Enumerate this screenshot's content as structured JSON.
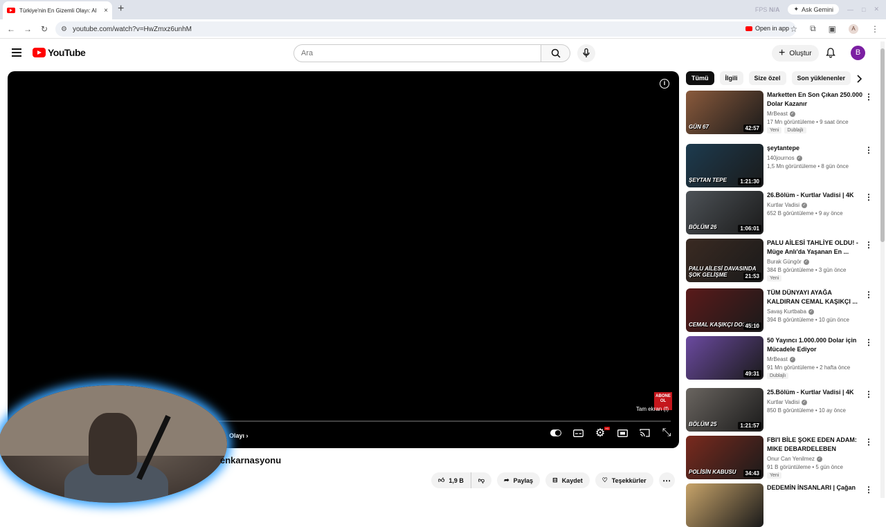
{
  "browser": {
    "tab_title": "Türkiye'nin En Gizemli Olayı: Al",
    "tab_close": "×",
    "new_tab": "+",
    "gemini_label": "Ask Gemini",
    "url": "youtube.com/watch?v=HwZmxz6unhM",
    "open_in_app": "Open in app",
    "profile_initial": "A",
    "fps_label": "FPS",
    "fps_value": "N/A"
  },
  "masthead": {
    "logo_text": "YouTube",
    "search_placeholder": "Ara",
    "create_label": "Oluştur",
    "avatar_initial": "B"
  },
  "player": {
    "abone_text": "ABONE OL",
    "fullscreen_tooltip": "Tam ekran (f)",
    "chapter_label": "Olayı",
    "progress_fraction": 0.0
  },
  "video": {
    "title_fragment": "enkarnasyonu",
    "like_count": "1,9 B",
    "share_label": "Paylaş",
    "save_label": "Kaydet",
    "thanks_label": "Teşekkürler"
  },
  "chips": [
    "Tümü",
    "İlgili",
    "Size özel",
    "Son yüklenenler"
  ],
  "recommendations": [
    {
      "title": "Marketten En Son Çıkan 250.000 Dolar Kazanır",
      "channel": "MrBeast",
      "verified": true,
      "stats": "17 Mn görüntüleme • 9 saat önce",
      "duration": "42:57",
      "badges": [
        "Yeni",
        "Dublajlı"
      ],
      "thumb_text": "GÜN 67",
      "thumb_color": "#8a5a3c"
    },
    {
      "title": "şeytantepe",
      "channel": "140journos",
      "verified": true,
      "stats": "1,5 Mn görüntüleme • 8 gün önce",
      "duration": "1:21:30",
      "badges": [],
      "thumb_text": "ŞEYTAN TEPE",
      "thumb_color": "#1d3b4f"
    },
    {
      "title": "26.Bölüm - Kurtlar Vadisi | 4K",
      "channel": "Kurtlar Vadisi",
      "verified": true,
      "stats": "652 B görüntüleme • 9 ay önce",
      "duration": "1:06:01",
      "badges": [],
      "thumb_text": "BÖLÜM 26",
      "thumb_color": "#4d5257"
    },
    {
      "title": "PALU AİLESİ TAHLİYE OLDU! - Müge Anlı'da Yaşanan En ...",
      "channel": "Burak Güngör",
      "verified": true,
      "stats": "384 B görüntüleme • 3 gün önce",
      "duration": "21:53",
      "badges": [
        "Yeni"
      ],
      "thumb_text": "PALU AİLESİ DAVASINDA ŞOK GELİŞME",
      "thumb_color": "#3a2a22"
    },
    {
      "title": "TÜM DÜNYAYI AYAĞA KALDIRAN CEMAL KAŞIKÇI ...",
      "channel": "Savaş Kurtbaba",
      "verified": true,
      "stats": "394 B görüntüleme • 10 gün önce",
      "duration": "45:10",
      "badges": [],
      "thumb_text": "CEMAL KAŞIKÇI DOSYASI",
      "thumb_color": "#5a1a1a"
    },
    {
      "title": "50 Yayıncı 1.000.000 Dolar için Mücadele Ediyor",
      "channel": "MrBeast",
      "verified": true,
      "stats": "91 Mn görüntüleme • 2 hafta önce",
      "duration": "49:31",
      "badges": [
        "Dublajlı"
      ],
      "thumb_text": "",
      "thumb_color": "#6b4aa0"
    },
    {
      "title": "25.Bölüm - Kurtlar Vadisi | 4K",
      "channel": "Kurtlar Vadisi",
      "verified": true,
      "stats": "850 B görüntüleme • 10 ay önce",
      "duration": "1:21:57",
      "badges": [],
      "thumb_text": "BÖLÜM 25",
      "thumb_color": "#6a6560"
    },
    {
      "title": "FBI'I BİLE ŞOKE EDEN ADAM: MIKE DEBARDELEBEN",
      "channel": "Onur Can Yenilmez",
      "verified": true,
      "stats": "91 B görüntüleme • 5 gün önce",
      "duration": "34:43",
      "badges": [
        "Yeni"
      ],
      "thumb_text": "POLİSİN KABUSU",
      "thumb_color": "#7a2a1e"
    },
    {
      "title": "DEDEMİN İNSANLARI | Çağan",
      "channel": "",
      "verified": false,
      "stats": "",
      "duration": "",
      "badges": [],
      "thumb_text": "",
      "thumb_color": "#c8a46a"
    }
  ]
}
